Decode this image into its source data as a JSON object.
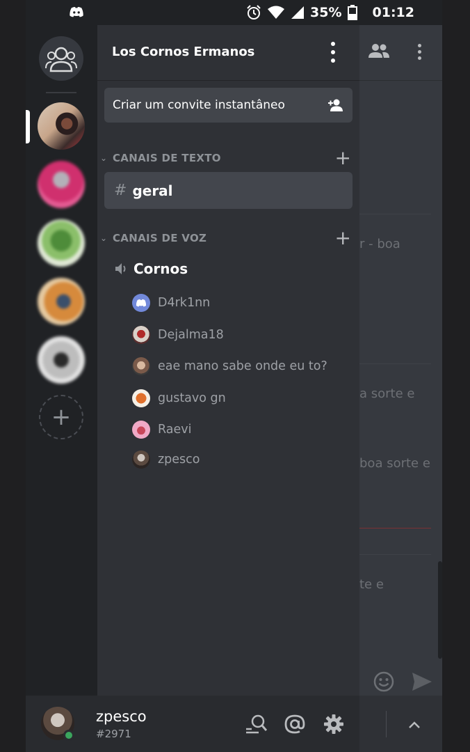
{
  "status_bar": {
    "battery": "35%",
    "time": "01:12",
    "icons": [
      "discord-icon",
      "alarm-icon",
      "wifi-icon",
      "signal-icon",
      "battery-icon"
    ]
  },
  "guild_rail": {
    "home_icon": "direct-messages-icon",
    "add_icon": "plus-icon"
  },
  "server": {
    "name": "Los Cornos Ermanos",
    "menu_icon": "kebab-menu-icon"
  },
  "invite": {
    "label": "Criar um convite instantâneo",
    "icon": "add-person-icon"
  },
  "text_category": {
    "label": "CANAIS DE TEXTO",
    "channels": [
      {
        "name": "geral",
        "active": true
      }
    ]
  },
  "voice_category": {
    "label": "CANAIS DE VOZ",
    "channels": [
      {
        "name": "Cornos",
        "members": [
          {
            "name": "D4rk1nn"
          },
          {
            "name": "Dejalma18"
          },
          {
            "name": "eae mano sabe onde eu to?"
          },
          {
            "name": "gustavo gn"
          },
          {
            "name": "Raevi"
          },
          {
            "name": "zpesco"
          }
        ]
      }
    ]
  },
  "background_chat": {
    "fragments": [
      "r - boa",
      "a sorte e",
      "boa sorte e",
      "te e"
    ]
  },
  "user_panel": {
    "username": "zpesco",
    "discriminator": "#2971",
    "status_color": "#3ba55d",
    "icons": [
      "search-friends-icon",
      "mention-icon",
      "settings-gear-icon"
    ]
  },
  "colors": {
    "accent": "#7289da",
    "online": "#3ba55d"
  }
}
